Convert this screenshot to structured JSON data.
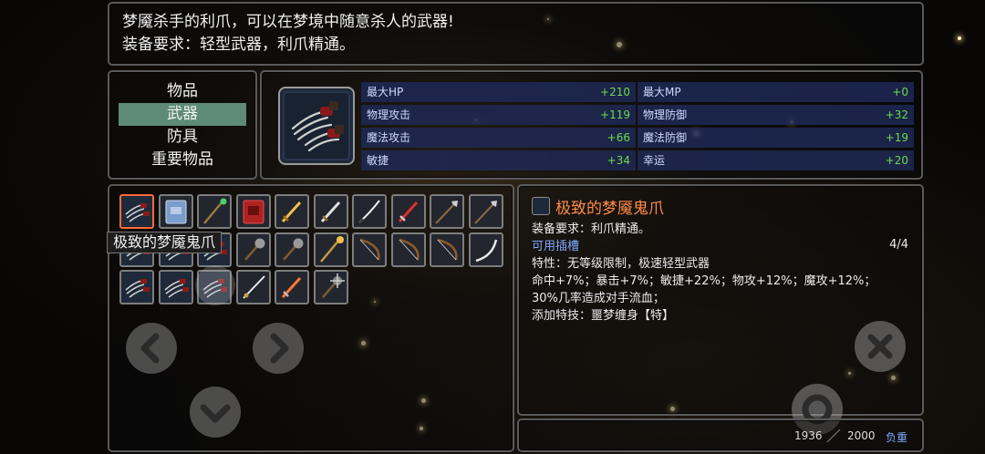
{
  "description": {
    "line1": "梦魇杀手的利爪，可以在梦境中随意杀人的武器!",
    "line2": "装备要求：轻型武器，利爪精通。"
  },
  "categories": [
    {
      "label": "物品",
      "active": false
    },
    {
      "label": "武器",
      "active": true
    },
    {
      "label": "防具",
      "active": false
    },
    {
      "label": "重要物品",
      "active": false
    }
  ],
  "stats": [
    {
      "label": "最大HP",
      "value": "+210"
    },
    {
      "label": "最大MP",
      "value": "+0"
    },
    {
      "label": "物理攻击",
      "value": "+119"
    },
    {
      "label": "物理防御",
      "value": "+32"
    },
    {
      "label": "魔法攻击",
      "value": "+66"
    },
    {
      "label": "魔法防御",
      "value": "+19"
    },
    {
      "label": "敏捷",
      "value": "+34"
    },
    {
      "label": "幸运",
      "value": "+20"
    }
  ],
  "inventory": {
    "tooltip": "极致的梦魇鬼爪",
    "rows": [
      [
        "claw-icon",
        "spellbook-blue-icon",
        "staff-green-icon",
        "spellbook-red-icon",
        "sword-gold-icon",
        "sword-silver-icon",
        "katana-icon",
        "sword-red-icon",
        "spear-icon",
        "spear-icon"
      ],
      [
        "claw-icon",
        "claw-icon",
        "claw-icon",
        "mace-icon",
        "mace-icon",
        "staff-gold-icon",
        "bow-icon",
        "bow-icon",
        "bow-icon",
        "scimitar-icon"
      ],
      [
        "claw-icon",
        "claw-icon",
        "claw-icon",
        "rapier-icon",
        "sword-fire-icon",
        "mace-spiked-icon"
      ]
    ]
  },
  "detail": {
    "title": "极致的梦魇鬼爪",
    "requirement": "装备要求：利爪精通。",
    "sockets_label": "可用插槽",
    "sockets_count": "4/4",
    "traits": "特性：无等级限制，极速轻型武器",
    "bonuses": "命中+7%；暴击+7%；敏捷+22%；物攻+12%；魔攻+12%；",
    "bleed": "30%几率造成对手流血；",
    "skill": "添加特技：噩梦缠身【特】"
  },
  "weight": {
    "current": "1936",
    "max": "2000",
    "label": "负重"
  },
  "buttons": {
    "prev": "chevron-left-icon",
    "next": "chevron-right-icon",
    "down": "chevron-down-icon",
    "close": "close-icon",
    "action": "ring-icon"
  }
}
